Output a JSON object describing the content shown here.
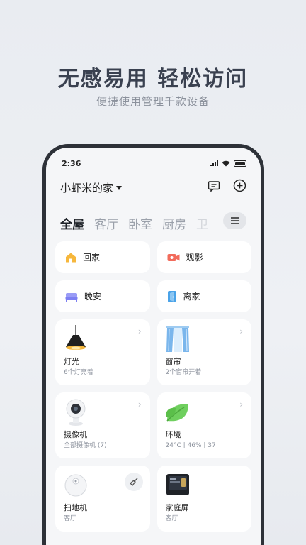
{
  "promo": {
    "headline": "无感易用  轻松访问",
    "subline": "便捷使用管理千款设备"
  },
  "status_bar": {
    "time": "2:36"
  },
  "home": {
    "title": "小虾米的家"
  },
  "tabs": [
    {
      "label": "全屋"
    },
    {
      "label": "客厅"
    },
    {
      "label": "卧室"
    },
    {
      "label": "厨房"
    },
    {
      "label": "卫"
    }
  ],
  "scenes": [
    {
      "label": "回家",
      "icon": "house-icon",
      "color": "#f6b73c"
    },
    {
      "label": "观影",
      "icon": "camera-icon",
      "color": "#f26b5b"
    },
    {
      "label": "晚安",
      "icon": "bed-icon",
      "color": "#7d7ff2"
    },
    {
      "label": "离家",
      "icon": "door-icon",
      "color": "#4aa3e8"
    }
  ],
  "devices": [
    {
      "name": "灯光",
      "status": "6个灯亮着",
      "icon": "pendant-lamp-icon"
    },
    {
      "name": "窗帘",
      "status": "2个窗帘开着",
      "icon": "curtain-icon"
    },
    {
      "name": "摄像机",
      "status": "全部摄像机 (7)",
      "icon": "security-camera-icon"
    },
    {
      "name": "环境",
      "status": "24°C | 46% | 37",
      "icon": "leaf-icon"
    },
    {
      "name": "扫地机",
      "status": "客厅",
      "icon": "robot-vacuum-icon"
    },
    {
      "name": "家庭屏",
      "status": "客厅",
      "icon": "smart-display-icon"
    }
  ]
}
